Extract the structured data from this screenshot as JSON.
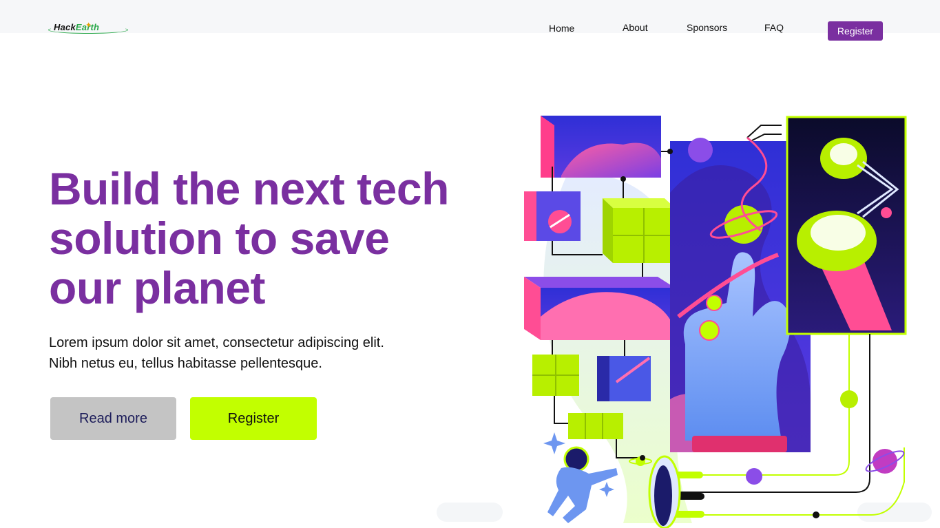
{
  "brand": {
    "logo_text_1": "Hack",
    "logo_text_2": "Earth",
    "accent": "#7a2fa0",
    "lime": "#c2ff00"
  },
  "nav": {
    "home": "Home",
    "about": "About",
    "sponsors": "Sponsors",
    "faq": "FAQ",
    "register": "Register"
  },
  "hero": {
    "title_line_1": "Build the next tech",
    "title_line_2": "solution to save",
    "title_line_3": "our planet",
    "subtitle_line_1": "Lorem ipsum dolor sit amet, consectetur adipiscing elit.",
    "subtitle_line_2": "Nibh netus eu, tellus habitasse pellentesque.",
    "read_more": "Read more",
    "register": "Register"
  },
  "illustration": {
    "icon": "space-tech-illustration"
  }
}
